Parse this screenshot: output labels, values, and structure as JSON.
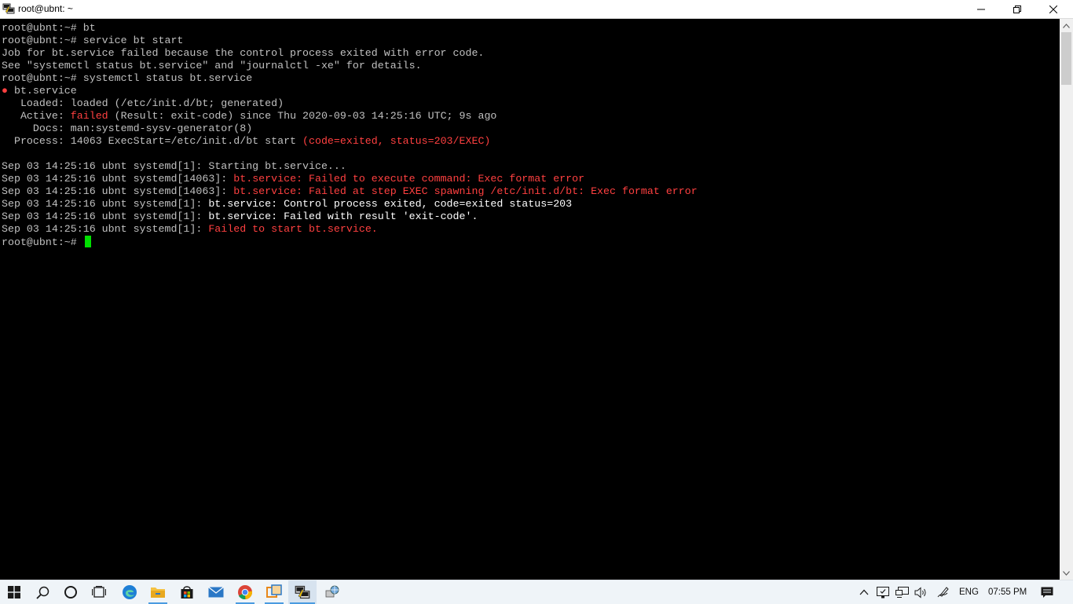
{
  "window": {
    "title": "root@ubnt: ~",
    "icon": "putty-icon"
  },
  "terminal": {
    "lines": [
      [
        {
          "t": "root@ubnt:~# bt",
          "c": ""
        }
      ],
      [
        {
          "t": "root@ubnt:~# service bt start",
          "c": ""
        }
      ],
      [
        {
          "t": "Job for bt.service failed because the control process exited with error code.",
          "c": ""
        }
      ],
      [
        {
          "t": "See \"systemctl status bt.service\" and \"journalctl -xe\" for details.",
          "c": ""
        }
      ],
      [
        {
          "t": "root@ubnt:~# systemctl status bt.service",
          "c": ""
        }
      ],
      [
        {
          "t": "●",
          "c": "red"
        },
        {
          "t": " bt.service",
          "c": ""
        }
      ],
      [
        {
          "t": "   Loaded: loaded (/etc/init.d/bt; generated)",
          "c": ""
        }
      ],
      [
        {
          "t": "   Active: ",
          "c": ""
        },
        {
          "t": "failed",
          "c": "red"
        },
        {
          "t": " (Result: exit-code) since Thu 2020-09-03 14:25:16 UTC; 9s ago",
          "c": ""
        }
      ],
      [
        {
          "t": "     Docs: man:systemd-sysv-generator(8)",
          "c": ""
        }
      ],
      [
        {
          "t": "  Process: 14063 ExecStart=/etc/init.d/bt start ",
          "c": ""
        },
        {
          "t": "(code=exited, status=203/EXEC)",
          "c": "red"
        }
      ],
      [
        {
          "t": "",
          "c": ""
        }
      ],
      [
        {
          "t": "Sep 03 14:25:16 ubnt systemd[1]: Starting bt.service...",
          "c": ""
        }
      ],
      [
        {
          "t": "Sep 03 14:25:16 ubnt systemd[14063]: ",
          "c": ""
        },
        {
          "t": "bt.service: Failed to execute command: Exec format error",
          "c": "red"
        }
      ],
      [
        {
          "t": "Sep 03 14:25:16 ubnt systemd[14063]: ",
          "c": ""
        },
        {
          "t": "bt.service: Failed at step EXEC spawning /etc/init.d/bt: Exec format error",
          "c": "red"
        }
      ],
      [
        {
          "t": "Sep 03 14:25:16 ubnt systemd[1]: ",
          "c": ""
        },
        {
          "t": "bt.service: Control process exited, code=exited status=203",
          "c": "bold"
        }
      ],
      [
        {
          "t": "Sep 03 14:25:16 ubnt systemd[1]: ",
          "c": ""
        },
        {
          "t": "bt.service: Failed with result 'exit-code'.",
          "c": "bold"
        }
      ],
      [
        {
          "t": "Sep 03 14:25:16 ubnt systemd[1]: ",
          "c": ""
        },
        {
          "t": "Failed to start bt.service.",
          "c": "red"
        }
      ],
      [
        {
          "t": "root@ubnt:~# ",
          "c": ""
        }
      ]
    ],
    "cursor_color": "#00e000"
  },
  "taskbar": {
    "items": [
      {
        "name": "start-button",
        "icon": "windows-logo-icon"
      },
      {
        "name": "search-button",
        "icon": "search-icon"
      },
      {
        "name": "cortana-button",
        "icon": "circle-icon"
      },
      {
        "name": "task-view-button",
        "icon": "task-view-icon"
      },
      {
        "name": "edge-button",
        "icon": "edge-icon"
      },
      {
        "name": "file-explorer-button",
        "icon": "folder-icon"
      },
      {
        "name": "store-button",
        "icon": "store-icon"
      },
      {
        "name": "mail-button",
        "icon": "mail-icon"
      },
      {
        "name": "chrome-button",
        "icon": "chrome-icon"
      },
      {
        "name": "app-button",
        "icon": "orange-window-icon"
      },
      {
        "name": "putty-taskbar-button",
        "icon": "putty-icon"
      },
      {
        "name": "network-app-button",
        "icon": "network-globe-icon"
      }
    ],
    "tray": {
      "language": "ENG",
      "time": "07:55 PM"
    }
  },
  "colors": {
    "error": "#ff4040",
    "text": "#c0c0c0",
    "accent": "#4a9be0"
  }
}
